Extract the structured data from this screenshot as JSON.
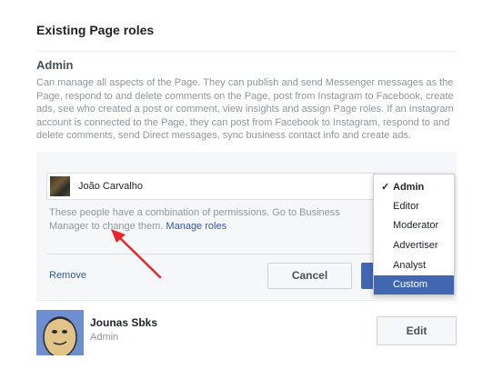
{
  "section_title": "Existing Page roles",
  "admin_role": {
    "heading": "Admin",
    "description": "Can manage all aspects of the Page. They can publish and send Messenger messages as the Page, respond to and delete comments on the Page, post from Instagram to Facebook, create ads, see who created a post or comment, view insights and assign Page roles. If an Instagram account is connected to the Page, they can post from Facebook to Instagram, respond to and delete comments, send Direct messages, sync business contact info and create ads."
  },
  "editor_panel": {
    "person_name": "João Carvalho",
    "permission_note": "These people have a combination of permissions. Go to Business Manager to change them.",
    "manage_roles_link": "Manage roles",
    "remove_link": "Remove",
    "cancel_label": "Cancel"
  },
  "role_dropdown": {
    "selected": "Admin",
    "highlighted": "Custom",
    "options": [
      "Admin",
      "Editor",
      "Moderator",
      "Advertiser",
      "Analyst",
      "Custom"
    ]
  },
  "members": [
    {
      "name": "Jounas Sbks",
      "role": "Admin",
      "edit_label": "Edit"
    }
  ],
  "colors": {
    "link": "#365899",
    "accent": "#4267b2",
    "annotation_arrow": "#e8262b"
  }
}
